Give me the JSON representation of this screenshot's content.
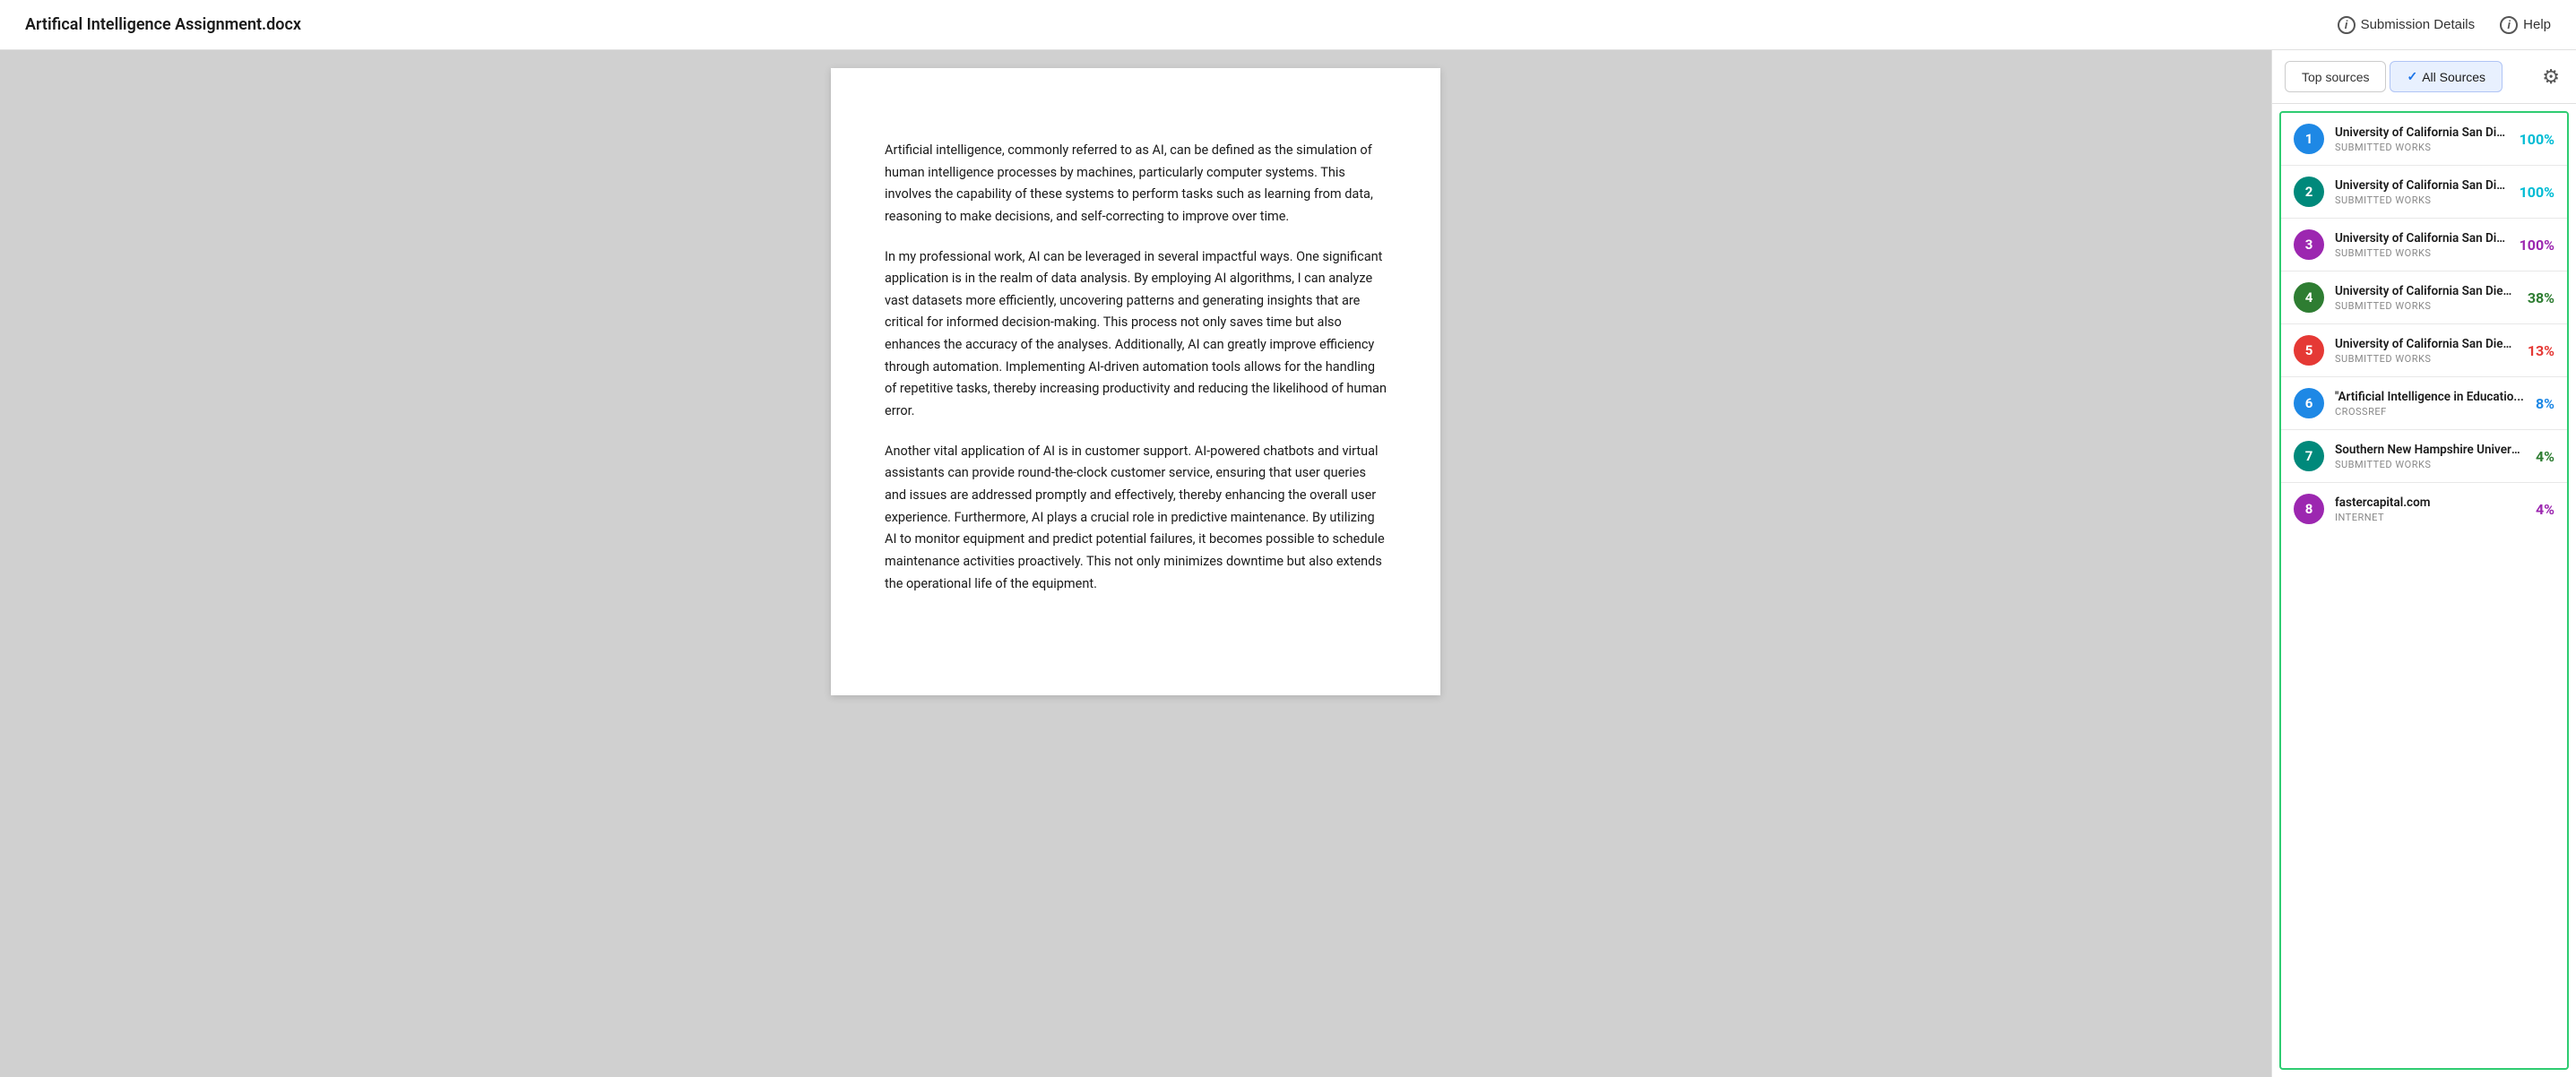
{
  "header": {
    "title": "Artifical Intelligence Assignment.docx",
    "submission_details_label": "Submission Details",
    "help_label": "Help"
  },
  "tabs": {
    "top_sources_label": "Top sources",
    "all_sources_label": "All Sources",
    "active": "all_sources"
  },
  "document": {
    "paragraphs": [
      "Artificial intelligence, commonly referred to as AI, can be defined as the simulation of human intelligence processes by machines, particularly computer systems. This involves the capability of these systems to perform tasks such as learning from data, reasoning to make decisions, and self-correcting to improve over time.",
      "In my professional work, AI can be leveraged in several impactful ways. One significant application is in the realm of data analysis. By employing AI algorithms, I can analyze vast datasets more efficiently, uncovering patterns and generating insights that are critical for informed decision-making. This process not only saves time but also enhances the accuracy of the analyses. Additionally, AI can greatly improve efficiency through automation. Implementing AI-driven automation tools allows for the handling of repetitive tasks, thereby increasing productivity and reducing the likelihood of human error.",
      "Another vital application of AI is in customer support. AI-powered chatbots and virtual assistants can provide round-the-clock customer service, ensuring that user queries and issues are addressed promptly and effectively, thereby enhancing the overall user experience. Furthermore, AI plays a crucial role in predictive maintenance. By utilizing AI to monitor equipment and predict potential failures, it becomes possible to schedule maintenance activities proactively. This not only minimizes downtime but also extends the operational life of the equipment."
    ]
  },
  "sources": [
    {
      "rank": 1,
      "name": "University of California San Die...",
      "type": "SUBMITTED WORKS",
      "percentage": "100%",
      "pct_color": "#00bcd4",
      "badge_color": "#1e88e5"
    },
    {
      "rank": 2,
      "name": "University of California San Die...",
      "type": "SUBMITTED WORKS",
      "percentage": "100%",
      "pct_color": "#00bcd4",
      "badge_color": "#00897b"
    },
    {
      "rank": 3,
      "name": "University of California San Die...",
      "type": "SUBMITTED WORKS",
      "percentage": "100%",
      "pct_color": "#9c27b0",
      "badge_color": "#9c27b0"
    },
    {
      "rank": 4,
      "name": "University of California San Dieg...",
      "type": "SUBMITTED WORKS",
      "percentage": "38%",
      "pct_color": "#2e7d32",
      "badge_color": "#2e7d32"
    },
    {
      "rank": 5,
      "name": "University of California San Dieg...",
      "type": "SUBMITTED WORKS",
      "percentage": "13%",
      "pct_color": "#e53935",
      "badge_color": "#e53935"
    },
    {
      "rank": 6,
      "name": "\"Artificial Intelligence in Educatio...",
      "type": "CROSSREF",
      "percentage": "8%",
      "pct_color": "#1e88e5",
      "badge_color": "#1e88e5"
    },
    {
      "rank": 7,
      "name": "Southern New Hampshire Univers...",
      "type": "SUBMITTED WORKS",
      "percentage": "4%",
      "pct_color": "#2e7d32",
      "badge_color": "#00897b"
    },
    {
      "rank": 8,
      "name": "fastercapital.com",
      "type": "INTERNET",
      "percentage": "4%",
      "pct_color": "#9c27b0",
      "badge_color": "#9c27b0"
    }
  ]
}
